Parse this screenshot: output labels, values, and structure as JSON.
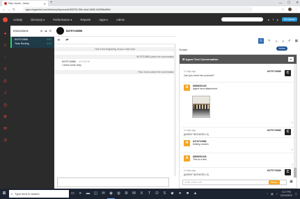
{
  "browser": {
    "tab_title": "Paul Jones - Inbox",
    "new_tab": "+",
    "url": "apps.ringcentral.com/directory/#/person/b283f752-39fe-4ba2-8b85-2c82f8bc8964",
    "window": {
      "minimize": "—",
      "maximize": "☐",
      "close": "✕"
    }
  },
  "appnav": {
    "menu": [
      {
        "label": "Activity"
      },
      {
        "label": "Directory ▾"
      },
      {
        "label": "Performance ▾"
      },
      {
        "label": "Reports"
      },
      {
        "label": "Apps ▾"
      },
      {
        "label": "Admin"
      }
    ],
    "on_queue": "On Queue"
  },
  "interactions": {
    "title": "Interactions",
    "item": {
      "number": "8479710886",
      "time": "0:01",
      "queue": "Texts Routing",
      "time2": "0:01"
    }
  },
  "chat": {
    "header_number": "8479710886",
    "begin_text": "This is the beginning of your chat room.",
    "joined1": "8479710886 joined the conversation",
    "msg_from": "8479710886",
    "msg_time": "4:27:50 PM",
    "msg_text": "I need some help",
    "joined2": "Paul Jones joined the conversation"
  },
  "right": {
    "scripts_label": "Scripts",
    "verbal": "Verbal",
    "panel_title": "Agent Text Conversation",
    "entries": [
      {
        "ago": "11 days ago",
        "num": "8479710886",
        "text": "Can you send me a picture?",
        "badge": "C"
      },
      {
        "badge": "A",
        "name": "8886652428",
        "text": "Agent sent attachment"
      },
      {
        "ago": "11 days ago",
        "num": "8479710886",
        "text": "[AGENT INITIATED: 0]",
        "badge": "C"
      },
      {
        "badge": "A",
        "name": "8479710886",
        "text": "testing custom"
      },
      {
        "badge": "A",
        "name": "8886652428",
        "text": "This is a test"
      },
      {
        "ago": "11 days ago",
        "num": "8479710886",
        "text": "[AGENT INITIATED: 0]",
        "badge": "C"
      }
    ],
    "input_placeholder": "Enter chat to call",
    "send_label": "Send ▸"
  },
  "taskbar": {
    "search_placeholder": "Type here to search",
    "time": "3:17 PM",
    "date": "11/21/2019"
  }
}
